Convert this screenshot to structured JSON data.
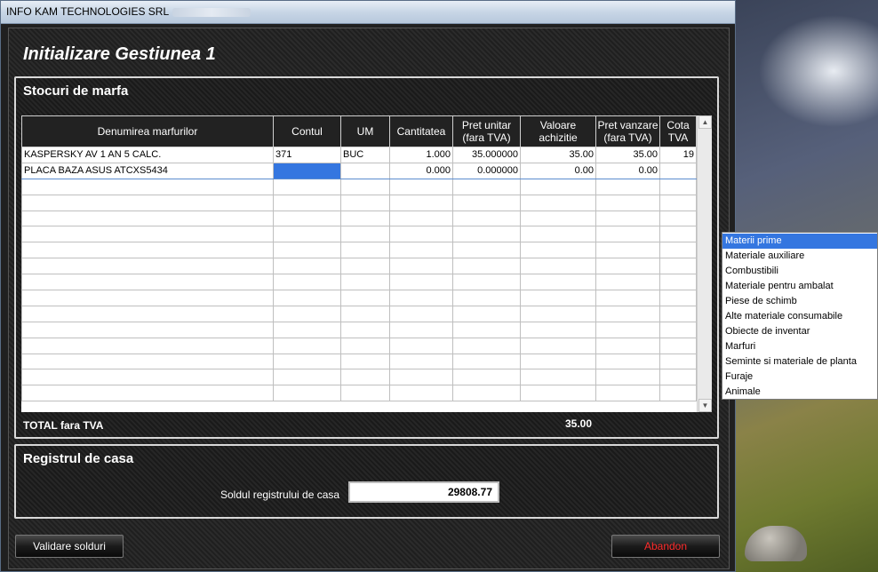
{
  "window": {
    "title": "INFO KAM TECHNOLOGIES SRL",
    "heading": "Initializare Gestiunea 1"
  },
  "stock": {
    "title": "Stocuri de marfa",
    "columns": [
      "Denumirea marfurilor",
      "Contul",
      "UM",
      "Cantitatea",
      "Pret unitar (fara TVA)",
      "Valoare achizitie",
      "Pret vanzare (fara TVA)",
      "Cota TVA"
    ],
    "rows": [
      [
        "KASPERSKY AV 1 AN 5 CALC.",
        "371",
        "BUC",
        "1.000",
        "35.000000",
        "35.00",
        "35.00",
        "19"
      ],
      [
        "PLACA BAZA ASUS ATCXS5434",
        "",
        "",
        "0.000",
        "0.000000",
        "0.00",
        "0.00",
        ""
      ]
    ],
    "total_label": "TOTAL fara TVA",
    "total_value": "35.00"
  },
  "cash": {
    "title": "Registrul de casa",
    "label": "Soldul registrului de casa",
    "value": "29808.77"
  },
  "buttons": {
    "validate": "Validare solduri",
    "abandon": "Abandon"
  },
  "dropdown": {
    "selected_index": 0,
    "options": [
      "Materii prime",
      "Materiale auxiliare",
      "Combustibili",
      "Materiale pentru ambalat",
      "Piese de schimb",
      "Alte materiale consumabile",
      "Obiecte de inventar",
      "Marfuri",
      "Seminte si materiale de planta",
      "Furaje",
      "Animale"
    ]
  },
  "colors": {
    "selection": "#3476e0",
    "abandon_text": "#ff2b2b"
  }
}
